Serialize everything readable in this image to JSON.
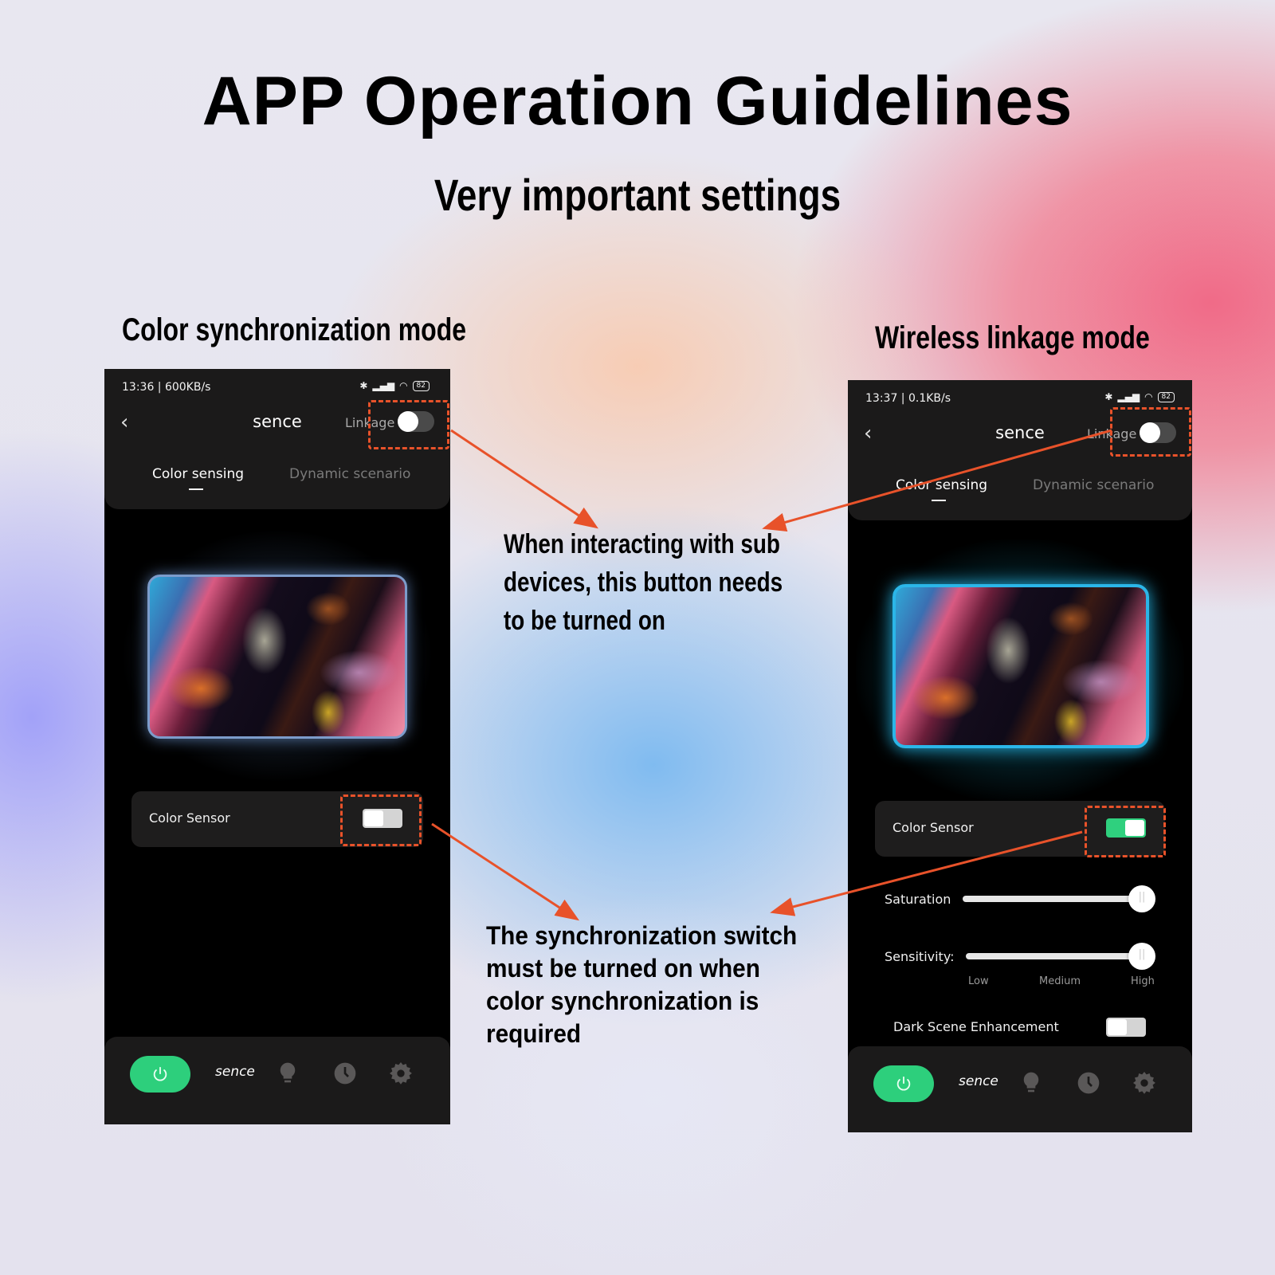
{
  "page": {
    "title": "APP Operation Guidelines",
    "subtitle": "Very important settings"
  },
  "left_panel": {
    "mode_label": "Color synchronization mode",
    "phone": {
      "status_time": "13:36 | 600KB/s",
      "battery": "82",
      "header_title": "sence",
      "linkage_label": "Linkage",
      "linkage_on": false,
      "tabs": [
        {
          "label": "Color sensing",
          "active": true
        },
        {
          "label": "Dynamic scenario",
          "active": false
        }
      ],
      "color_sensor_label": "Color Sensor",
      "color_sensor_on": false,
      "bottom_nav": {
        "power_icon": "power-icon",
        "sence_label": "sence",
        "icons": [
          "bulb-icon",
          "clock-icon",
          "gear-icon"
        ]
      }
    }
  },
  "right_panel": {
    "mode_label": "Wireless linkage mode",
    "phone": {
      "status_time": "13:37 | 0.1KB/s",
      "battery": "82",
      "header_title": "sence",
      "linkage_label": "Linkage",
      "linkage_on": false,
      "tabs": [
        {
          "label": "Color sensing",
          "active": true
        },
        {
          "label": "Dynamic scenario",
          "active": false
        }
      ],
      "color_sensor_label": "Color Sensor",
      "color_sensor_on": true,
      "saturation": {
        "label": "Saturation",
        "value_percent": 100
      },
      "sensitivity": {
        "label": "Sensitivity:",
        "options": [
          "Low",
          "Medium",
          "High"
        ],
        "selected": "High"
      },
      "dark_scene": {
        "label": "Dark Scene Enhancement",
        "on": false
      },
      "bottom_nav": {
        "power_icon": "power-icon",
        "sence_label": "sence",
        "icons": [
          "bulb-icon",
          "clock-icon",
          "gear-icon"
        ]
      }
    }
  },
  "notes": {
    "linkage_note": [
      "When interacting with sub",
      "devices, this button needs",
      "to be turned on"
    ],
    "sync_note": [
      "The synchronization switch",
      "must be turned on when",
      "color synchronization is",
      "required"
    ]
  },
  "colors": {
    "accent_green": "#2dcf7c",
    "annotation_red": "#e8522a",
    "phone_bg": "#000000",
    "panel_bg": "#1b1a1a"
  }
}
